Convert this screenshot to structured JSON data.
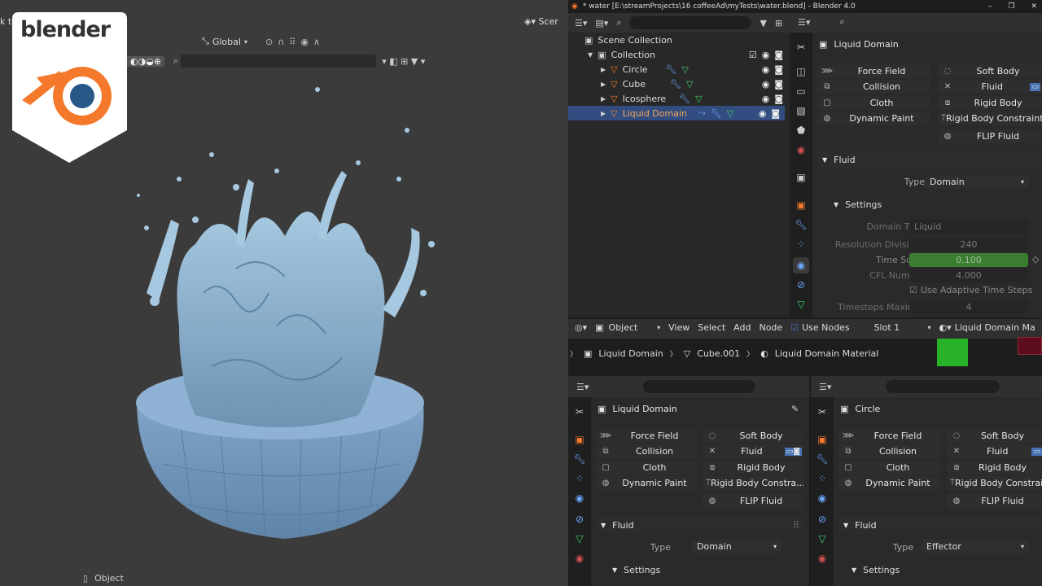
{
  "window": {
    "title": "* water [E:\\streamProjects\\16 coffeeAd\\myTests\\water.blend] - Blender 4.0"
  },
  "viewport": {
    "orientation": "Global",
    "mode": "Object",
    "scene_label": "Scer",
    "left_text": "k to"
  },
  "logo": {
    "text": "blender"
  },
  "outliner": {
    "root": "Scene Collection",
    "collection": "Collection",
    "items": [
      {
        "label": "Circle"
      },
      {
        "label": "Cube"
      },
      {
        "label": "Icosphere"
      },
      {
        "label": "Liquid Domain",
        "selected": true
      }
    ]
  },
  "props_top": {
    "object_name": "Liquid Domain",
    "physics_buttons": [
      "Force Field",
      "Soft Body",
      "Collision",
      "Fluid",
      "Cloth",
      "Rigid Body",
      "Dynamic Paint",
      "Rigid Body Constraint",
      "FLIP Fluid"
    ],
    "fluid_panel": "Fluid",
    "type_label": "Type",
    "type_value": "Domain",
    "settings_panel": "Settings",
    "rows": [
      {
        "label": "Domain Type",
        "value": "Liquid"
      },
      {
        "label": "Resolution Divisions",
        "value": "240"
      },
      {
        "label": "Time Scale",
        "value": "0.100"
      },
      {
        "label": "CFL Number",
        "value": "4.000"
      },
      {
        "label": "Use Adaptive Time Steps",
        "value": ""
      },
      {
        "label": "Timesteps Maxim...",
        "value": "4"
      }
    ]
  },
  "node_editor": {
    "mode": "Object",
    "menu": [
      "View",
      "Select",
      "Add",
      "Node"
    ],
    "use_nodes": "Use Nodes",
    "slot": "Slot 1",
    "material": "Liquid Domain Ma",
    "breadcrumb": [
      "Liquid Domain",
      "Cube.001",
      "Liquid Domain Material"
    ]
  },
  "props_left": {
    "object_name": "Liquid Domain",
    "physics_buttons": [
      "Force Field",
      "Soft Body",
      "Collision",
      "Fluid",
      "Cloth",
      "Rigid Body",
      "Dynamic Paint",
      "Rigid Body Constra...",
      "FLIP Fluid"
    ],
    "fluid_panel": "Fluid",
    "type_label": "Type",
    "type_value": "Domain",
    "settings_panel": "Settings"
  },
  "props_right": {
    "object_name": "Circle",
    "physics_buttons": [
      "Force Field",
      "Soft Body",
      "Collision",
      "Fluid",
      "Cloth",
      "Rigid Body",
      "Dynamic Paint",
      "Rigid Body Constraint",
      "FLIP Fluid"
    ],
    "fluid_panel": "Fluid",
    "type_label": "Type",
    "type_value": "Effector",
    "settings_panel": "Settings"
  },
  "status": {
    "mode": "Object"
  },
  "colors": {
    "accent_green": "#3b7d31",
    "select_blue": "#334d80",
    "node_green": "#27b227",
    "node_red": "#5c0c1c",
    "logo_orange": "#f5792a",
    "logo_blue": "#265787"
  }
}
